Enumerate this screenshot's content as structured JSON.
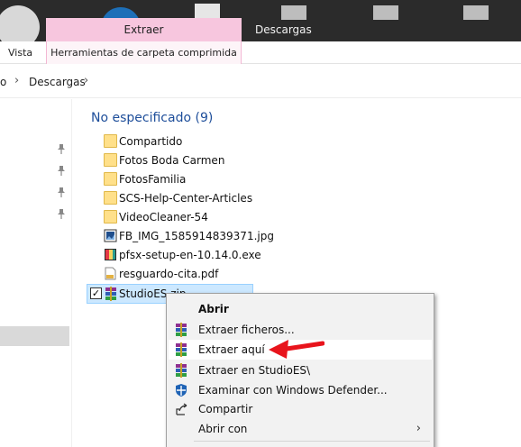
{
  "ribbon": {
    "context_tab": "Extraer",
    "tab_descargas": "Descargas",
    "tab_vista": "Vista",
    "tab_tools": "Herramientas de carpeta comprimida"
  },
  "address": {
    "crumb_prev": "o",
    "crumb_current": "Descargas"
  },
  "list": {
    "group_header": "No especificado (9)",
    "items": [
      {
        "label": "Compartido",
        "icon": "folder-icon"
      },
      {
        "label": "Fotos Boda Carmen",
        "icon": "folder-icon"
      },
      {
        "label": "FotosFamilia",
        "icon": "folder-icon"
      },
      {
        "label": "SCS-Help-Center-Articles",
        "icon": "folder-icon"
      },
      {
        "label": "VideoCleaner-54",
        "icon": "folder-icon"
      },
      {
        "label": "FB_IMG_1585914839371.jpg",
        "icon": "image-file-icon"
      },
      {
        "label": "pfsx-setup-en-10.14.0.exe",
        "icon": "exe-file-icon"
      },
      {
        "label": "resguardo-cita.pdf",
        "icon": "pdf-file-icon"
      }
    ],
    "selected_item": {
      "label": "StudioES.zip",
      "icon": "winrar-archive-icon",
      "checked": true
    }
  },
  "context_menu": {
    "items": [
      {
        "label": "Abrir",
        "bold": true
      },
      {
        "label": "Extraer ficheros...",
        "icon": "winrar-icon"
      },
      {
        "label": "Extraer aquí",
        "icon": "winrar-icon",
        "highlighted": true
      },
      {
        "label": "Extraer en StudioES\\",
        "icon": "winrar-icon"
      },
      {
        "label": "Examinar con Windows Defender...",
        "icon": "windows-defender-icon"
      },
      {
        "label": "Compartir",
        "icon": "share-icon"
      },
      {
        "label": "Abrir con",
        "has_submenu": true
      }
    ]
  },
  "colors": {
    "context_tab_bg": "#f7c6de",
    "selection_bg": "#cce8ff",
    "group_header": "#1e4e9a",
    "annotation_arrow": "#e8141c"
  }
}
